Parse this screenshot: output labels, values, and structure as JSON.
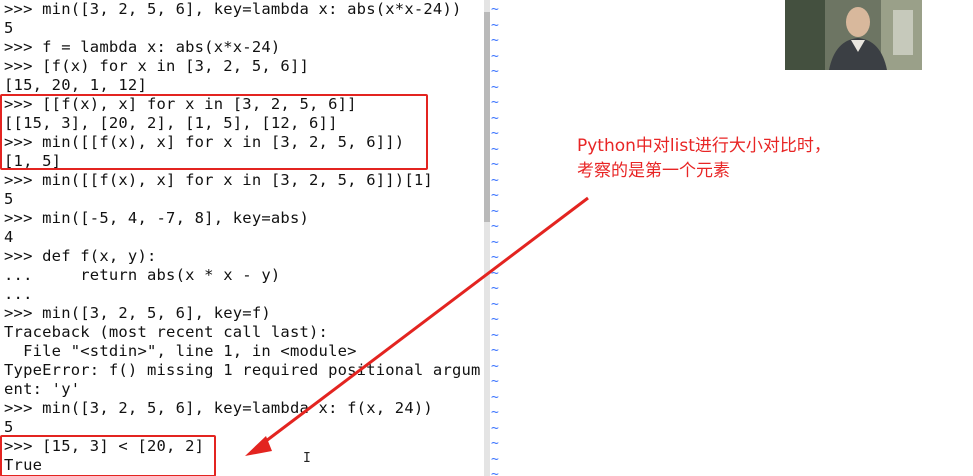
{
  "terminal": {
    "lines": [
      ">>> min([3, 2, 5, 6], key=lambda x: abs(x*x-24))",
      "5",
      ">>> f = lambda x: abs(x*x-24)",
      ">>> [f(x) for x in [3, 2, 5, 6]]",
      "[15, 20, 1, 12]",
      ">>> [[f(x), x] for x in [3, 2, 5, 6]]",
      "[[15, 3], [20, 2], [1, 5], [12, 6]]",
      ">>> min([[f(x), x] for x in [3, 2, 5, 6]])",
      "[1, 5]",
      ">>> min([[f(x), x] for x in [3, 2, 5, 6]])[1]",
      "5",
      ">>> min([-5, 4, -7, 8], key=abs)",
      "4",
      ">>> def f(x, y):",
      "...     return abs(x * x - y)",
      "...",
      ">>> min([3, 2, 5, 6], key=f)",
      "Traceback (most recent call last):",
      "  File \"<stdin>\", line 1, in <module>",
      "TypeError: f() missing 1 required positional argum",
      "ent: 'y'",
      ">>> min([3, 2, 5, 6], key=lambda x: f(x, 24))",
      "5",
      ">>> [15, 3] < [20, 2]",
      "True"
    ]
  },
  "editor": {
    "tilde_char": "~",
    "tilde_color": "#3a73ff"
  },
  "annotation": {
    "line1": "Python中对list进行大小对比时，",
    "line2": "考察的是第一个元素",
    "color": "#e82525"
  },
  "webcam": {
    "label": "presenter-video"
  },
  "colors": {
    "highlight": "#e32420",
    "terminal_text": "#111111",
    "background": "#ffffff"
  }
}
